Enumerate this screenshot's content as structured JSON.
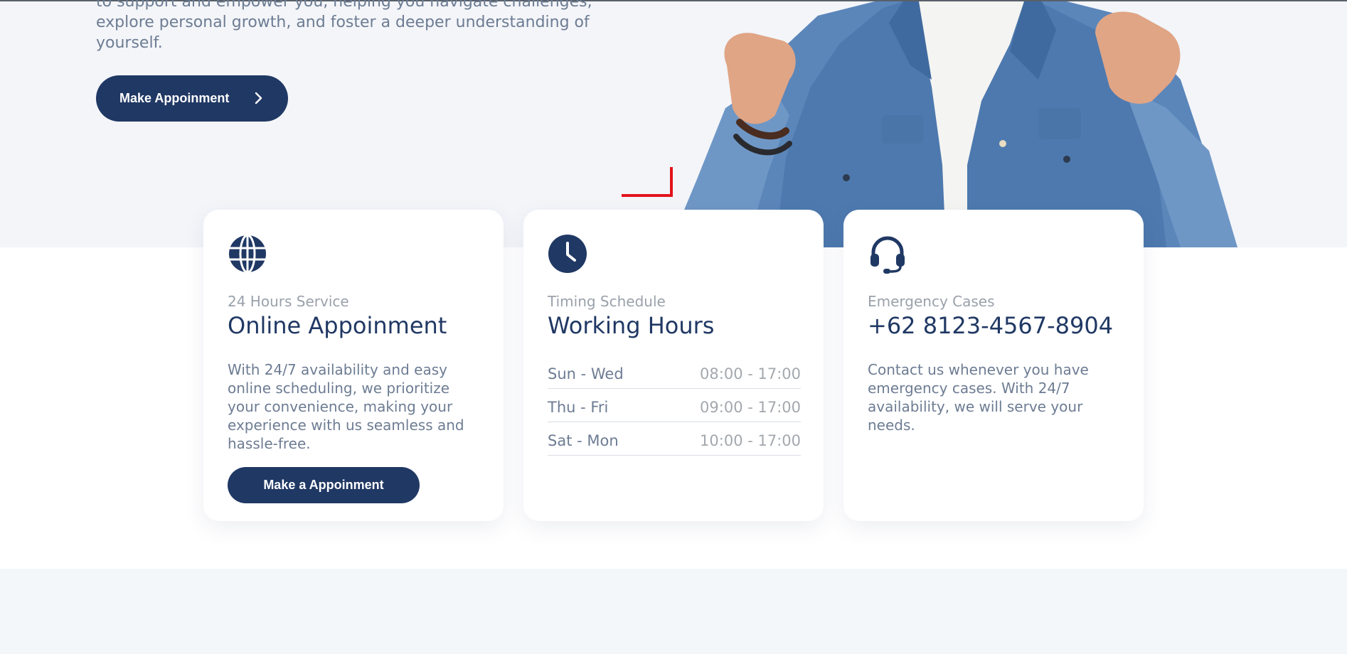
{
  "hero": {
    "text_lines": [
      "to support and empower you, helping you navigate challenges,",
      "explore personal growth, and foster a deeper understanding of",
      "yourself."
    ],
    "button_label": "Make Appoinment"
  },
  "cards": {
    "service": {
      "kicker": "24 Hours Service",
      "title": "Online Appoinment",
      "body": "With 24/7 availability and easy online scheduling, we prioritize your convenience, making your experience with us seamless and hassle-free.",
      "button_label": "Make a Appoinment",
      "icon": "globe-icon"
    },
    "schedule": {
      "kicker": "Timing Schedule",
      "title": "Working Hours",
      "icon": "clock-icon",
      "rows": [
        {
          "day": "Sun - Wed",
          "time": "08:00 - 17:00"
        },
        {
          "day": "Thu - Fri",
          "time": "09:00 - 17:00"
        },
        {
          "day": "Sat - Mon",
          "time": "10:00 - 17:00"
        }
      ]
    },
    "emergency": {
      "kicker": "Emergency Cases",
      "title": "+62 8123-4567-8904",
      "body": "Contact us whenever you have emergency cases. With 24/7 availability, we will serve your needs.",
      "icon": "headset-icon"
    }
  },
  "colors": {
    "brand_navy": "#203864",
    "accent_red": "#e3141b",
    "muted_text": "#6d7c93",
    "hero_bg": "#f3f5f9"
  }
}
